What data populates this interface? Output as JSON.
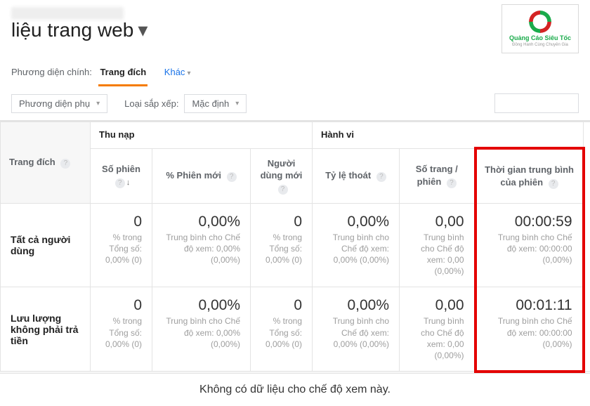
{
  "page": {
    "title": "liệu trang web",
    "primary_dim_label": "Phương diện chính:",
    "tabs": [
      "Trang đích",
      "Khác"
    ],
    "secondary_dim_label": "Phương diện phụ",
    "sort_label": "Loại sắp xếp:",
    "sort_value": "Mặc định",
    "no_data": "Không có dữ liệu cho chế độ xem này."
  },
  "logo": {
    "name": "Quảng Cáo Siêu Tốc",
    "sub": "Đồng Hành Cùng Chuyên Gia"
  },
  "columns": {
    "dim": "Trang đích",
    "groups": {
      "acq": "Thu nạp",
      "beh": "Hành vi"
    },
    "sub": {
      "sessions": "Số phiên",
      "new_sessions": "% Phiên mới",
      "new_users": "Người dùng mới",
      "bounce": "Tỷ lệ thoát",
      "pages_per": "Số trang / phiên",
      "avg_time": "Thời gian trung bình của phiên"
    }
  },
  "rows": [
    {
      "label": "Tất cả người dùng",
      "sessions": {
        "v": "0",
        "s": "% trong Tổng số: 0,00% (0)"
      },
      "new_sessions": {
        "v": "0,00%",
        "s": "Trung bình cho Chế độ xem: 0,00% (0,00%)"
      },
      "new_users": {
        "v": "0",
        "s": "% trong Tổng số: 0,00% (0)"
      },
      "bounce": {
        "v": "0,00%",
        "s": "Trung bình cho Chế độ xem: 0,00% (0,00%)"
      },
      "pages_per": {
        "v": "0,00",
        "s": "Trung bình cho Chế độ xem: 0,00 (0,00%)"
      },
      "avg_time": {
        "v": "00:00:59",
        "s": "Trung bình cho Chế độ xem: 00:00:00 (0,00%)"
      }
    },
    {
      "label": "Lưu lượng không phải trả tiền",
      "sessions": {
        "v": "0",
        "s": "% trong Tổng số: 0,00% (0)"
      },
      "new_sessions": {
        "v": "0,00%",
        "s": "Trung bình cho Chế độ xem: 0,00% (0,00%)"
      },
      "new_users": {
        "v": "0",
        "s": "% trong Tổng số: 0,00% (0)"
      },
      "bounce": {
        "v": "0,00%",
        "s": "Trung bình cho Chế độ xem: 0,00% (0,00%)"
      },
      "pages_per": {
        "v": "0,00",
        "s": "Trung bình cho Chế độ xem: 0,00 (0,00%)"
      },
      "avg_time": {
        "v": "00:01:11",
        "s": "Trung bình cho Chế độ xem: 00:00:00 (0,00%)"
      }
    }
  ]
}
